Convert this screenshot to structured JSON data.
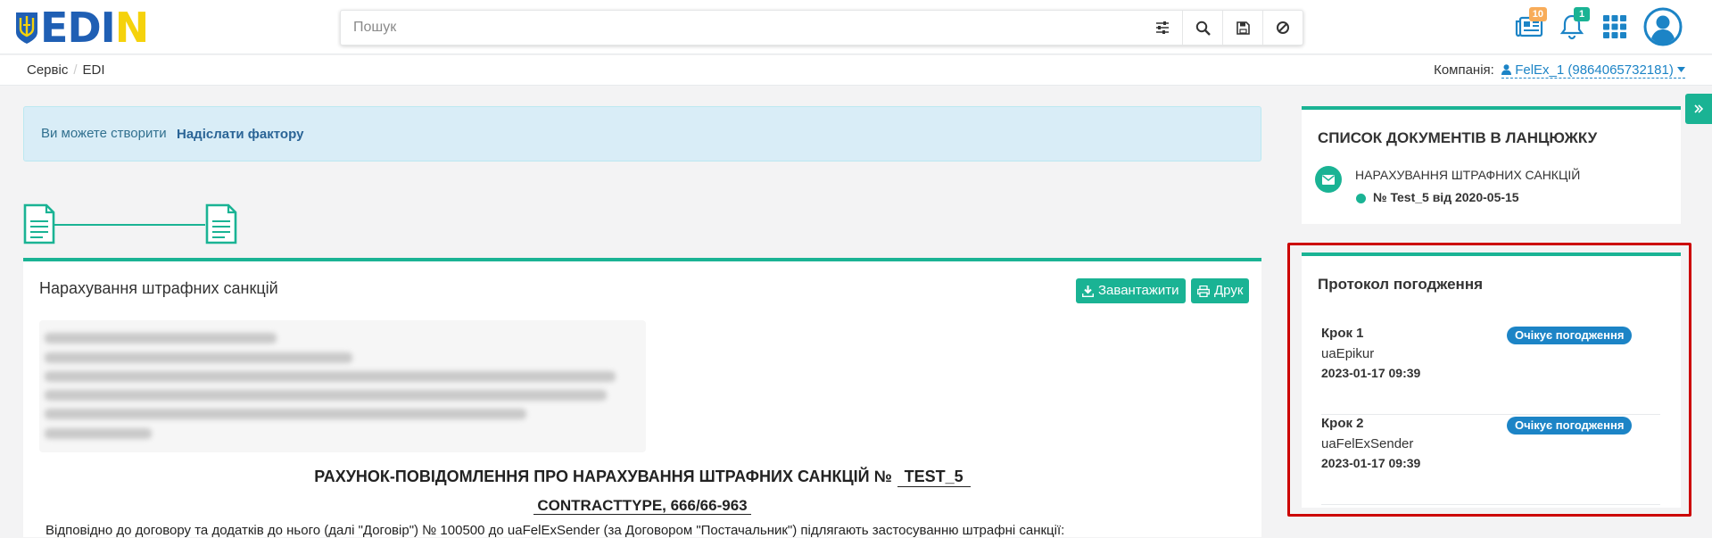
{
  "header": {
    "logo_text": "EDIN",
    "search_placeholder": "Пошук",
    "notifications": {
      "documents_count": "10",
      "bell_count": "1"
    }
  },
  "breadcrumb": {
    "items": [
      "Сервіс",
      "EDI"
    ]
  },
  "company": {
    "label": "Компанія:",
    "value": "FelEx_1 (9864065732181)"
  },
  "alert": {
    "text": "Ви можете створити",
    "link": "Надіслати фактору"
  },
  "document": {
    "title": "Нарахування штрафних санкцій",
    "download_label": "Завантажити",
    "print_label": "Друк",
    "heading": "РАХУНОК-ПОВІДОМЛЕННЯ ПРО НАРАХУВАННЯ ШТРАФНИХ САНКЦІЙ №",
    "heading_number": "TEST_5",
    "contract_line": "CONTRACTTYPE, 666/66-963",
    "paragraph": "Відповідно до договору та додатків до нього (далі \"Договір\") № 100500 до uaFelExSender (за Договором \"Постачальник\") підлягають застосуванню штрафні санкції:"
  },
  "chain_list": {
    "title": "СПИСОК ДОКУМЕНТІВ В ЛАНЦЮЖКУ",
    "doc_type": "НАРАХУВАННЯ ШТРАФНИХ САНКЦІЙ",
    "doc_number": "№ Test_5 від 2020-05-15"
  },
  "protocol": {
    "title": "Протокол погодження",
    "steps": [
      {
        "name": "Крок 1",
        "user": "uaEpikur",
        "date": "2023-01-17 09:39",
        "status": "Очікує погодження"
      },
      {
        "name": "Крок 2",
        "user": "uaFelExSender",
        "date": "2023-01-17 09:39",
        "status": "Очікує погодження"
      }
    ]
  },
  "colors": {
    "accent": "#1ab394",
    "link": "#1c84c6",
    "alert_bg": "#d9edf7",
    "highlight_border": "#cc0000",
    "logo_blue": "#1f5fb4",
    "logo_yellow": "#f5d20c"
  }
}
